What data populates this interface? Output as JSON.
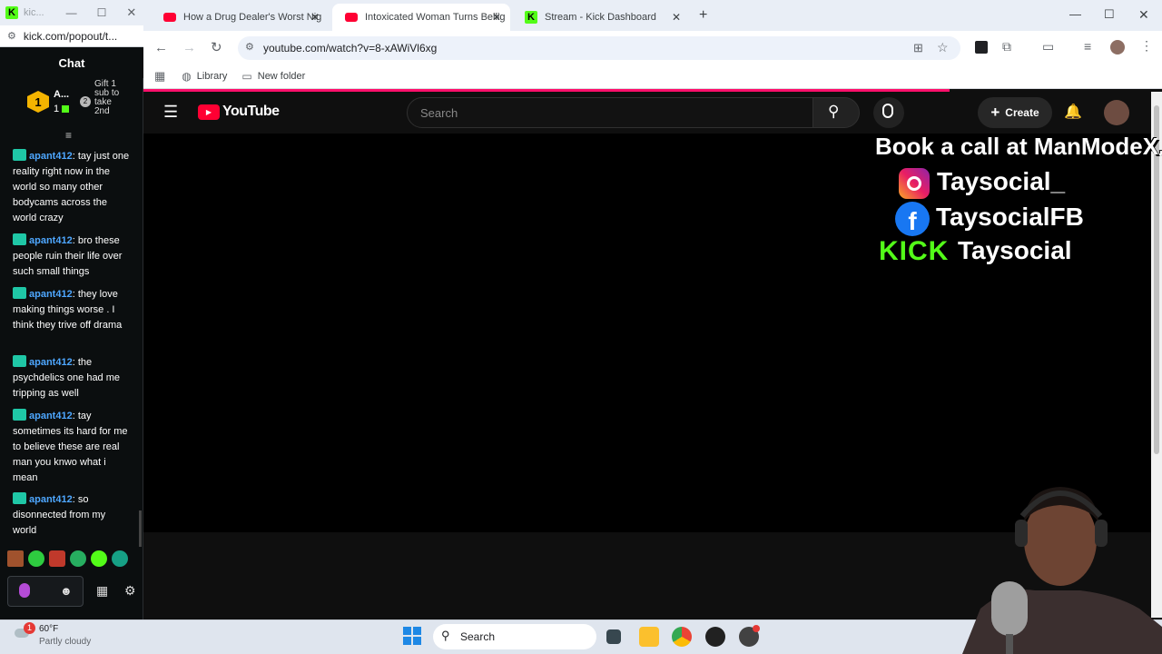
{
  "kick_window": {
    "tab_title": "kic...",
    "address": "kick.com/popout/t...",
    "chat_title": "Chat",
    "gift": {
      "rank": "1",
      "name": "A...",
      "count": "1",
      "badge_num": "2",
      "text": "Gift 1 sub to take 2nd"
    },
    "messages": [
      {
        "user": "apant412",
        "text": "tay just one reality right now in the world so many other bodycams across the world crazy"
      },
      {
        "user": "apant412",
        "text": "bro these people ruin their life over such small things"
      },
      {
        "user": "apant412",
        "text": "they love making things worse . I think they trive off drama"
      },
      {
        "user": "apant412",
        "text": "the psychdelics one had me tripping as well"
      },
      {
        "user": "apant412",
        "text": "tay sometimes its hard for me to believe these are real man you knwo what i mean"
      },
      {
        "user": "apant412",
        "text": "so disonnected from my world"
      }
    ]
  },
  "browser": {
    "tabs": [
      {
        "title": "How a Drug Dealer's Worst Nig",
        "favicon_color": "#ff0033"
      },
      {
        "title": "Intoxicated Woman Turns Bellig",
        "favicon_color": "#ff0033"
      },
      {
        "title": "Stream - Kick Dashboard",
        "favicon_color": "#53fc18"
      }
    ],
    "new_tab": "+",
    "url": "youtube.com/watch?v=8-xAWiVl6xg",
    "bookmarks": [
      "Library",
      "New folder"
    ]
  },
  "youtube": {
    "logo_text": "YouTube",
    "search_placeholder": "Search",
    "create_label": "Create"
  },
  "overlay": {
    "line1": "Book a call at ManModeX.co",
    "instagram": "Taysocial_",
    "facebook": "TaysocialFB",
    "kick_logo": "KICK",
    "kick_handle": "Taysocial"
  },
  "taskbar": {
    "weather_badge": "1",
    "temperature": "60°F",
    "condition": "Partly cloudy",
    "search_label": "Search"
  }
}
